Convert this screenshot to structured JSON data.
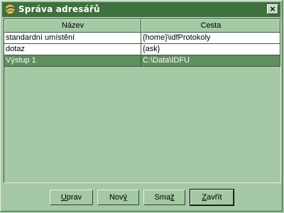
{
  "window": {
    "title": "Správa adresářů",
    "close_glyph": "×"
  },
  "icons": {
    "app": "app-globe-icon",
    "close": "close-icon"
  },
  "table": {
    "columns": [
      "Název",
      "Cesta"
    ],
    "rows": [
      {
        "name": "standardní umístění",
        "path": "{home}\\idfProtokoly",
        "selected": false
      },
      {
        "name": "dotaz",
        "path": "{ask}",
        "selected": false
      },
      {
        "name": "Výstup 1",
        "path": "C:\\Data\\IDFU",
        "selected": true
      }
    ]
  },
  "buttons": {
    "edit": {
      "accel": "U",
      "rest": "prav"
    },
    "new": {
      "pre": "Nov",
      "accel": "ý"
    },
    "delete": {
      "pre": "Sma",
      "accel": "ž"
    },
    "close": {
      "accel": "Z",
      "rest": "avřít"
    }
  },
  "colors": {
    "titlebar": "#3f703f",
    "background": "#a5c8a5",
    "selection": "#5f8f5f"
  }
}
